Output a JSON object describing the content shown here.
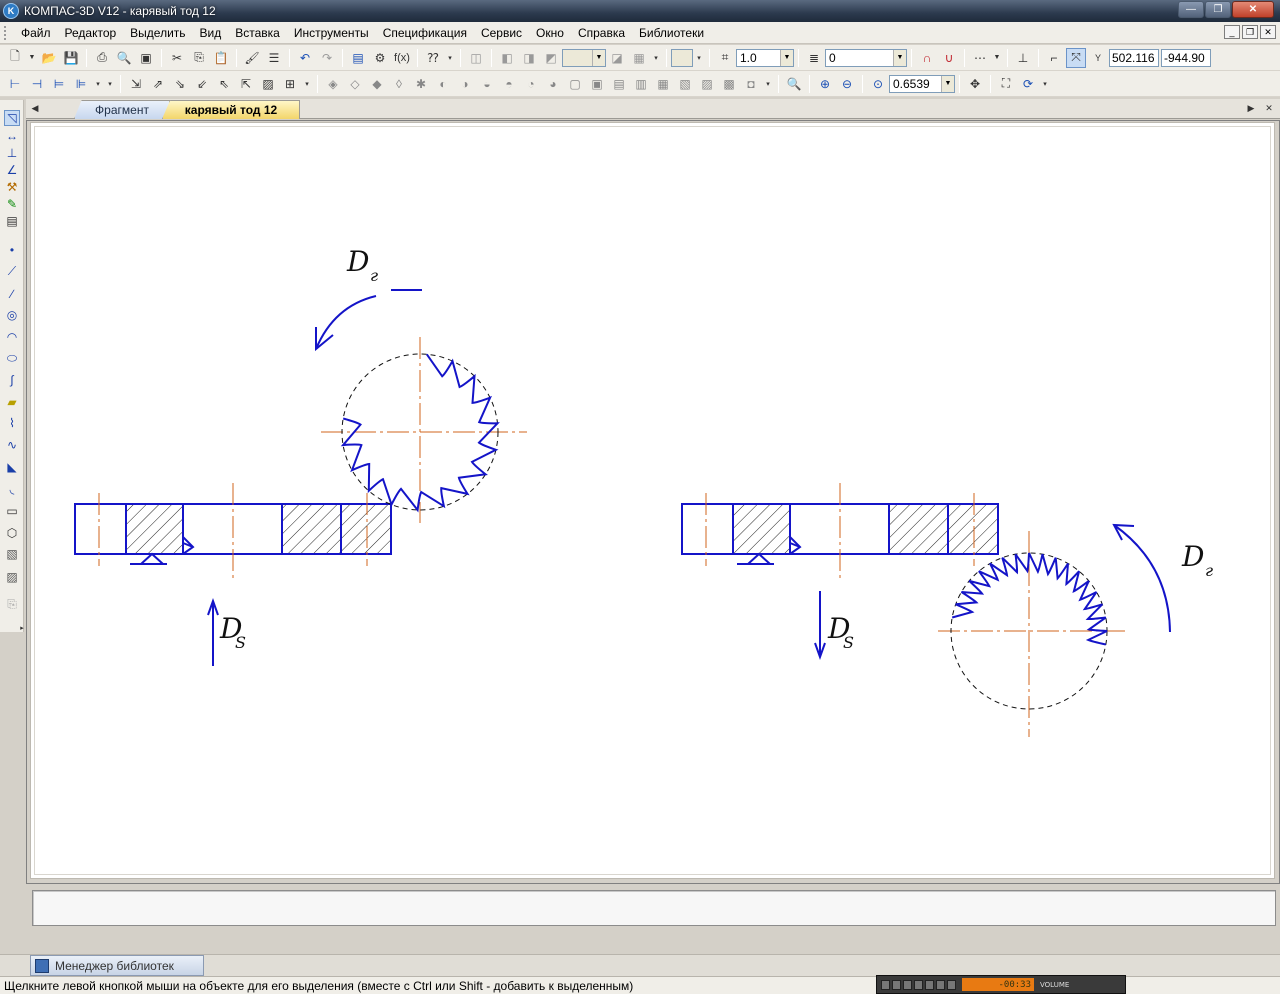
{
  "window": {
    "title": "КОМПАС-3D V12 - карявый тод 12",
    "app_icon": "kompas-logo-icon"
  },
  "menu": [
    "Файл",
    "Редактор",
    "Выделить",
    "Вид",
    "Вставка",
    "Инструменты",
    "Спецификация",
    "Сервис",
    "Окно",
    "Справка",
    "Библиотеки"
  ],
  "toolbar": {
    "line_scale": "1.0",
    "layer": "0",
    "coord_x": "502.116",
    "coord_y": "-944.90",
    "zoom": "0.6539"
  },
  "tabs": {
    "inactive": "Фрагмент",
    "active": "карявый тод 12"
  },
  "drawing": {
    "labels": {
      "left_rotation": "D",
      "left_rotation_sub": "г",
      "left_feed": "D",
      "left_feed_sub": "S",
      "right_rotation": "D",
      "right_rotation_sub": "г",
      "right_feed": "D",
      "right_feed_sub": "S"
    },
    "colors": {
      "geometry": "#1414c8",
      "axis": "#d2641e",
      "hatch": "#222222"
    },
    "left_cutter_teeth": 14,
    "right_cutter_teeth": 18
  },
  "library_tab": "Менеджер библиотек",
  "status": "Щелкните левой кнопкой мыши на объекте для его выделения (вместе с Ctrl или Shift - добавить к выделенным)",
  "player": {
    "time": "-00:33",
    "volume_label": "VOLUME"
  }
}
